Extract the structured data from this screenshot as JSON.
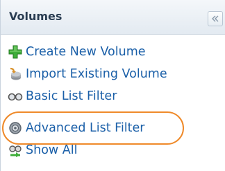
{
  "panel": {
    "title": "Volumes",
    "collapse_icon": "double-chevron-left-icon"
  },
  "menu": {
    "items": [
      {
        "label": "Create New Volume",
        "icon": "green-plus-icon"
      },
      {
        "label": "Import Existing Volume",
        "icon": "import-volume-icon"
      },
      {
        "label": "Basic List Filter",
        "icon": "glasses-filter-icon"
      },
      {
        "label": "Advanced List Filter",
        "icon": "gear-filter-icon"
      },
      {
        "label": "Show All",
        "icon": "show-all-icon"
      }
    ]
  },
  "colors": {
    "link": "#1a5fa8",
    "highlight": "#ef8a2a",
    "header_text": "#2a3d52"
  }
}
